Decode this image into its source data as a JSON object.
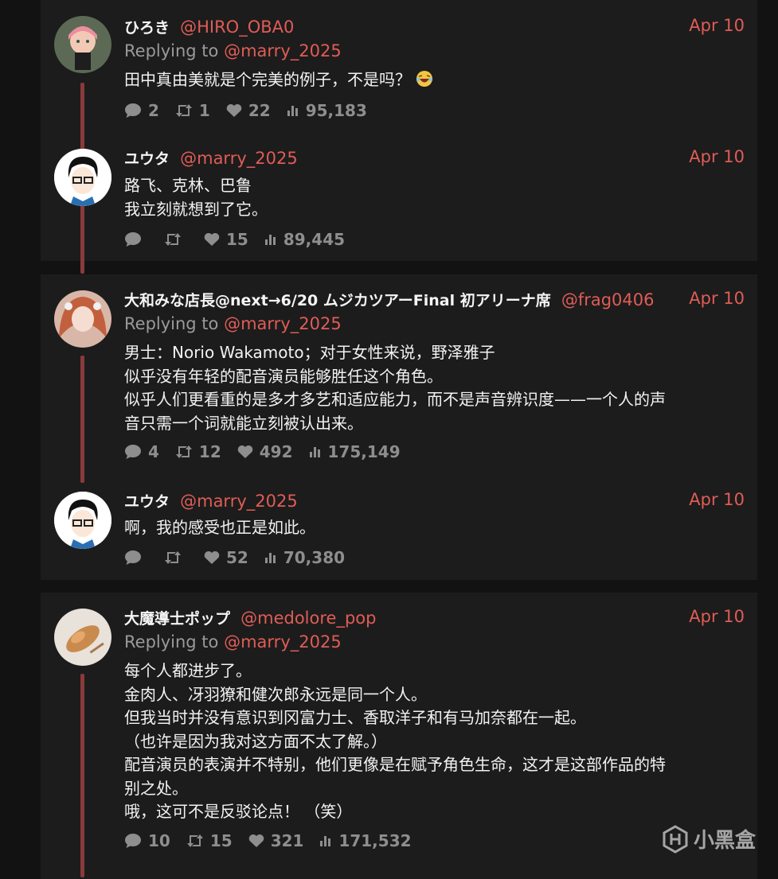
{
  "replying_to_prefix": "Replying to",
  "threads": [
    {
      "parent": {
        "name": "ひろき",
        "handle": "@HIRO_OBA0",
        "date": "Apr 10",
        "replying_to": "@marry_2025",
        "body": [
          "田中真由美就是个完美的例子，不是吗？"
        ],
        "emoji": "laughing-face",
        "stats": {
          "replies": "2",
          "retweets": "1",
          "likes": "22",
          "views": "95,183"
        }
      },
      "reply": {
        "name": "ユウタ",
        "handle": "@marry_2025",
        "date": "Apr 10",
        "body": [
          "路飞、克林、巴鲁",
          "我立刻就想到了它。"
        ],
        "stats": {
          "replies": "",
          "retweets": "",
          "likes": "15",
          "views": "89,445"
        }
      }
    },
    {
      "parent": {
        "name": "大和みな店長@next→6/20 ムジカツアーFinal 初アリーナ席",
        "handle": "@frag0406",
        "date": "Apr 10",
        "replying_to": "@marry_2025",
        "body": [
          "男士：Norio Wakamoto；对于女性来说，野泽雅子",
          "似乎没有年轻的配音演员能够胜任这个角色。",
          "似乎人们更看重的是多才多艺和适应能力，而不是声音辨识度——一个人的声",
          "音只需一个词就能立刻被认出来。"
        ],
        "stats": {
          "replies": "4",
          "retweets": "12",
          "likes": "492",
          "views": "175,149"
        }
      },
      "reply": {
        "name": "ユウタ",
        "handle": "@marry_2025",
        "date": "Apr 10",
        "body": [
          "啊，我的感受也正是如此。"
        ],
        "stats": {
          "replies": "",
          "retweets": "",
          "likes": "52",
          "views": "70,380"
        }
      }
    },
    {
      "parent": {
        "name": "大魔導士ポップ",
        "handle": "@medolore_pop",
        "date": "Apr 10",
        "replying_to": "@marry_2025",
        "body": [
          "每个人都进步了。",
          "金肉人、冴羽獠和健次郎永远是同一个人。",
          "但我当时并没有意识到冈富力士、香取洋子和有马加奈都在一起。",
          "（也许是因为我对这方面不太了解。）",
          "配音演员的表演并不特别，他们更像是在赋予角色生命，这才是这部作品的特",
          "别之处。",
          "哦，这可不是反驳论点！ （笑）"
        ],
        "stats": {
          "replies": "10",
          "retweets": "15",
          "likes": "321",
          "views": "171,532"
        }
      }
    }
  ],
  "watermark": "小黑盒",
  "colors": {
    "accent": "#e05c56",
    "muted": "#8e8e8e",
    "thread_line": "#8a3a3a",
    "card": "#1c1c1c",
    "background": "#121212"
  }
}
